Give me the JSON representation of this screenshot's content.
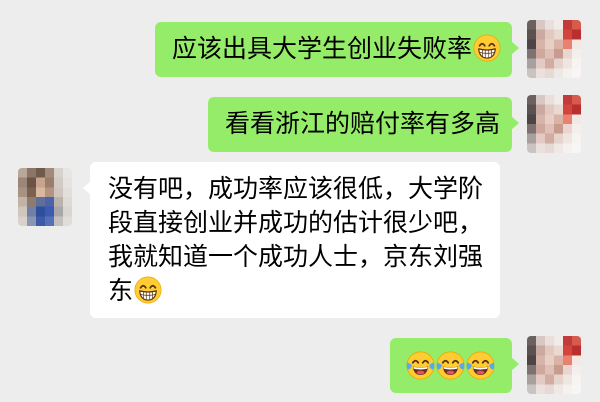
{
  "colors": {
    "background": "#EDEDED",
    "outgoing_bubble": "#95EC69",
    "incoming_bubble": "#FFFFFF",
    "text": "#000000"
  },
  "chat": {
    "messages": [
      {
        "text": "应该出具大学生创业失败率",
        "emoji_icons": [
          "grinning-face-with-smiling-eyes-icon"
        ]
      },
      {
        "text": "看看浙江的赔付率有多高",
        "emoji_icons": []
      },
      {
        "lines": [
          "没有吧，成功率应该很低，大学阶",
          "段直接创业并成功的估计很少吧，",
          "我就知道一个成功人士，京东刘强",
          "东"
        ],
        "emoji_icons": [
          "grinning-face-with-smiling-eyes-icon"
        ]
      },
      {
        "emoji_icons": [
          "face-with-tears-of-joy-icon",
          "face-with-tears-of-joy-icon",
          "face-with-tears-of-joy-icon"
        ]
      }
    ]
  }
}
